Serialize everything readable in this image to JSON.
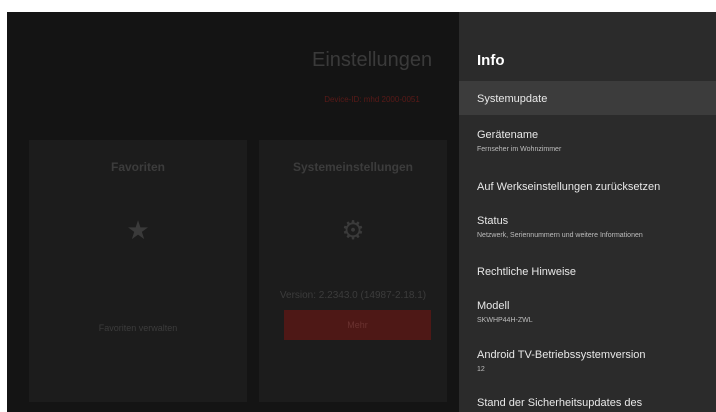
{
  "background": {
    "title": "Einstellungen",
    "device_id": "Device-ID: mhd 2000-0051",
    "favorites_card": {
      "title": "Favoriten",
      "icon": "star-icon",
      "action_label": "Favoriten verwalten"
    },
    "system_card": {
      "title": "Systemeinstellungen",
      "icon": "gear-icon",
      "version": "Version: 2.2343.0 (14987-2.18.1)",
      "button_label": "Mehr"
    }
  },
  "panel": {
    "title": "Info",
    "items": [
      {
        "label": "Systemupdate",
        "sub": "",
        "selected": true
      },
      {
        "label": "Gerätename",
        "sub": "Fernseher im Wohnzimmer"
      },
      {
        "label": "Auf Werkseinstellungen zurücksetzen",
        "sub": ""
      },
      {
        "label": "Status",
        "sub": "Netzwerk, Seriennummern und weitere Informationen"
      },
      {
        "label": "Rechtliche Hinweise",
        "sub": ""
      },
      {
        "label": "Modell",
        "sub": "SKWHP44H-ZWL"
      },
      {
        "label": "Android TV-Betriebssystemversion",
        "sub": "12"
      },
      {
        "label": "Stand der Sicherheitsupdates des",
        "sub": ""
      }
    ]
  },
  "colors": {
    "panel_bg": "#2b2b2b",
    "selected_bg": "#3c3c3c",
    "accent_dim": "#4e1816"
  }
}
